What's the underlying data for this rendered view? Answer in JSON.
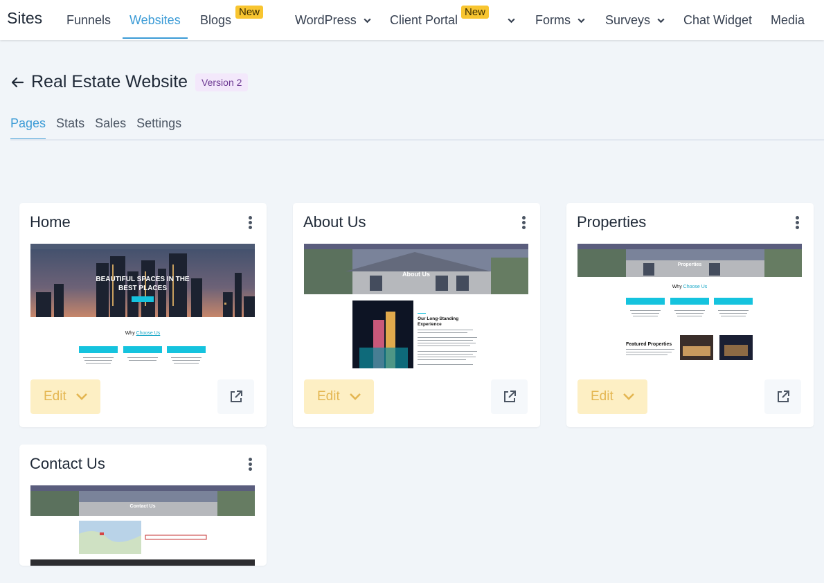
{
  "topnav": {
    "brand": "Sites",
    "items": [
      {
        "label": "Funnels"
      },
      {
        "label": "Websites"
      },
      {
        "label": "Blogs",
        "badge": "New"
      },
      {
        "label": "WordPress"
      },
      {
        "label": "Client Portal",
        "badge": "New"
      },
      {
        "label": "Forms"
      },
      {
        "label": "Surveys"
      },
      {
        "label": "Chat Widget"
      },
      {
        "label": "Media"
      }
    ]
  },
  "header": {
    "title": "Real Estate Website",
    "version": "Version 2"
  },
  "subtabs": [
    "Pages",
    "Stats",
    "Sales",
    "Settings"
  ],
  "cards": [
    {
      "title": "Home",
      "edit_label": "Edit",
      "thumb": {
        "hero_line1": "BEAUTIFUL SPACES IN THE",
        "hero_line2": "BEST PLACES",
        "why_prefix": "Why",
        "why_highlight": "Choose Us"
      }
    },
    {
      "title": "About Us",
      "edit_label": "Edit",
      "thumb": {
        "hero": "About Us",
        "section_line1": "Our Long-Standing",
        "section_line2": "Experience"
      }
    },
    {
      "title": "Properties",
      "edit_label": "Edit",
      "thumb": {
        "hero": "Properties",
        "why_prefix": "Why",
        "why_highlight": "Choose Us",
        "featured": "Featured Properties"
      }
    },
    {
      "title": "Contact Us",
      "edit_label": "Edit",
      "thumb": {
        "hero": "Contact Us"
      }
    }
  ],
  "colors": {
    "accent": "#3b9bd6",
    "badge_new": "#f8c530",
    "edit_bg": "#fdefc4",
    "edit_text": "#e4b651",
    "version_bg": "#f3e8fb",
    "version_text": "#6d3a93",
    "thumb_cyan": "#15c3de"
  },
  "icons": {
    "back": "arrow-left-icon",
    "kebab": "kebab-menu-icon",
    "open": "external-link-icon",
    "dropdown": "chevron-down-icon"
  }
}
